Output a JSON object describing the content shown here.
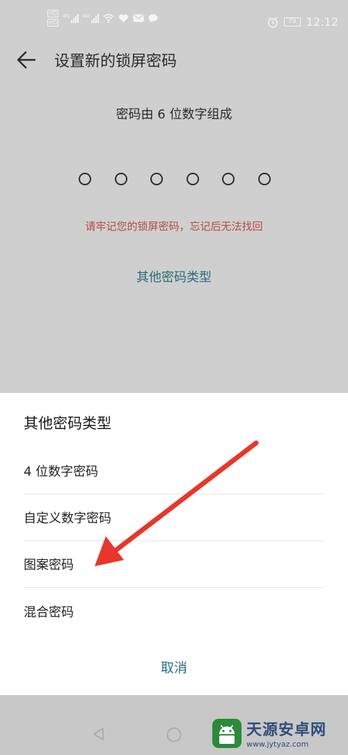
{
  "status_bar": {
    "hd_badge": "HD",
    "network_label": "4G",
    "battery": "79",
    "time": "12:12"
  },
  "header": {
    "title": "设置新的锁屏密码"
  },
  "main": {
    "hint": "密码由 6 位数字组成",
    "dot_count": 6,
    "warning": "请牢记您的锁屏密码，忘记后无法找回",
    "other_types_link": "其他密码类型"
  },
  "sheet": {
    "title": "其他密码类型",
    "options": [
      {
        "label": "4 位数字密码"
      },
      {
        "label": "自定义数字密码"
      },
      {
        "label": "图案密码"
      },
      {
        "label": "混合密码"
      }
    ],
    "cancel_label": "取消"
  },
  "annotation": {
    "arrow_color": "#e8362a"
  },
  "watermark": {
    "name": "天源安卓网",
    "url": "www.jytyaz.com"
  },
  "colors": {
    "dim_background": "#cfcfcf",
    "warning_red": "#b44a47",
    "link_teal": "#2a6a7a",
    "sheet_bg": "#ffffff"
  }
}
